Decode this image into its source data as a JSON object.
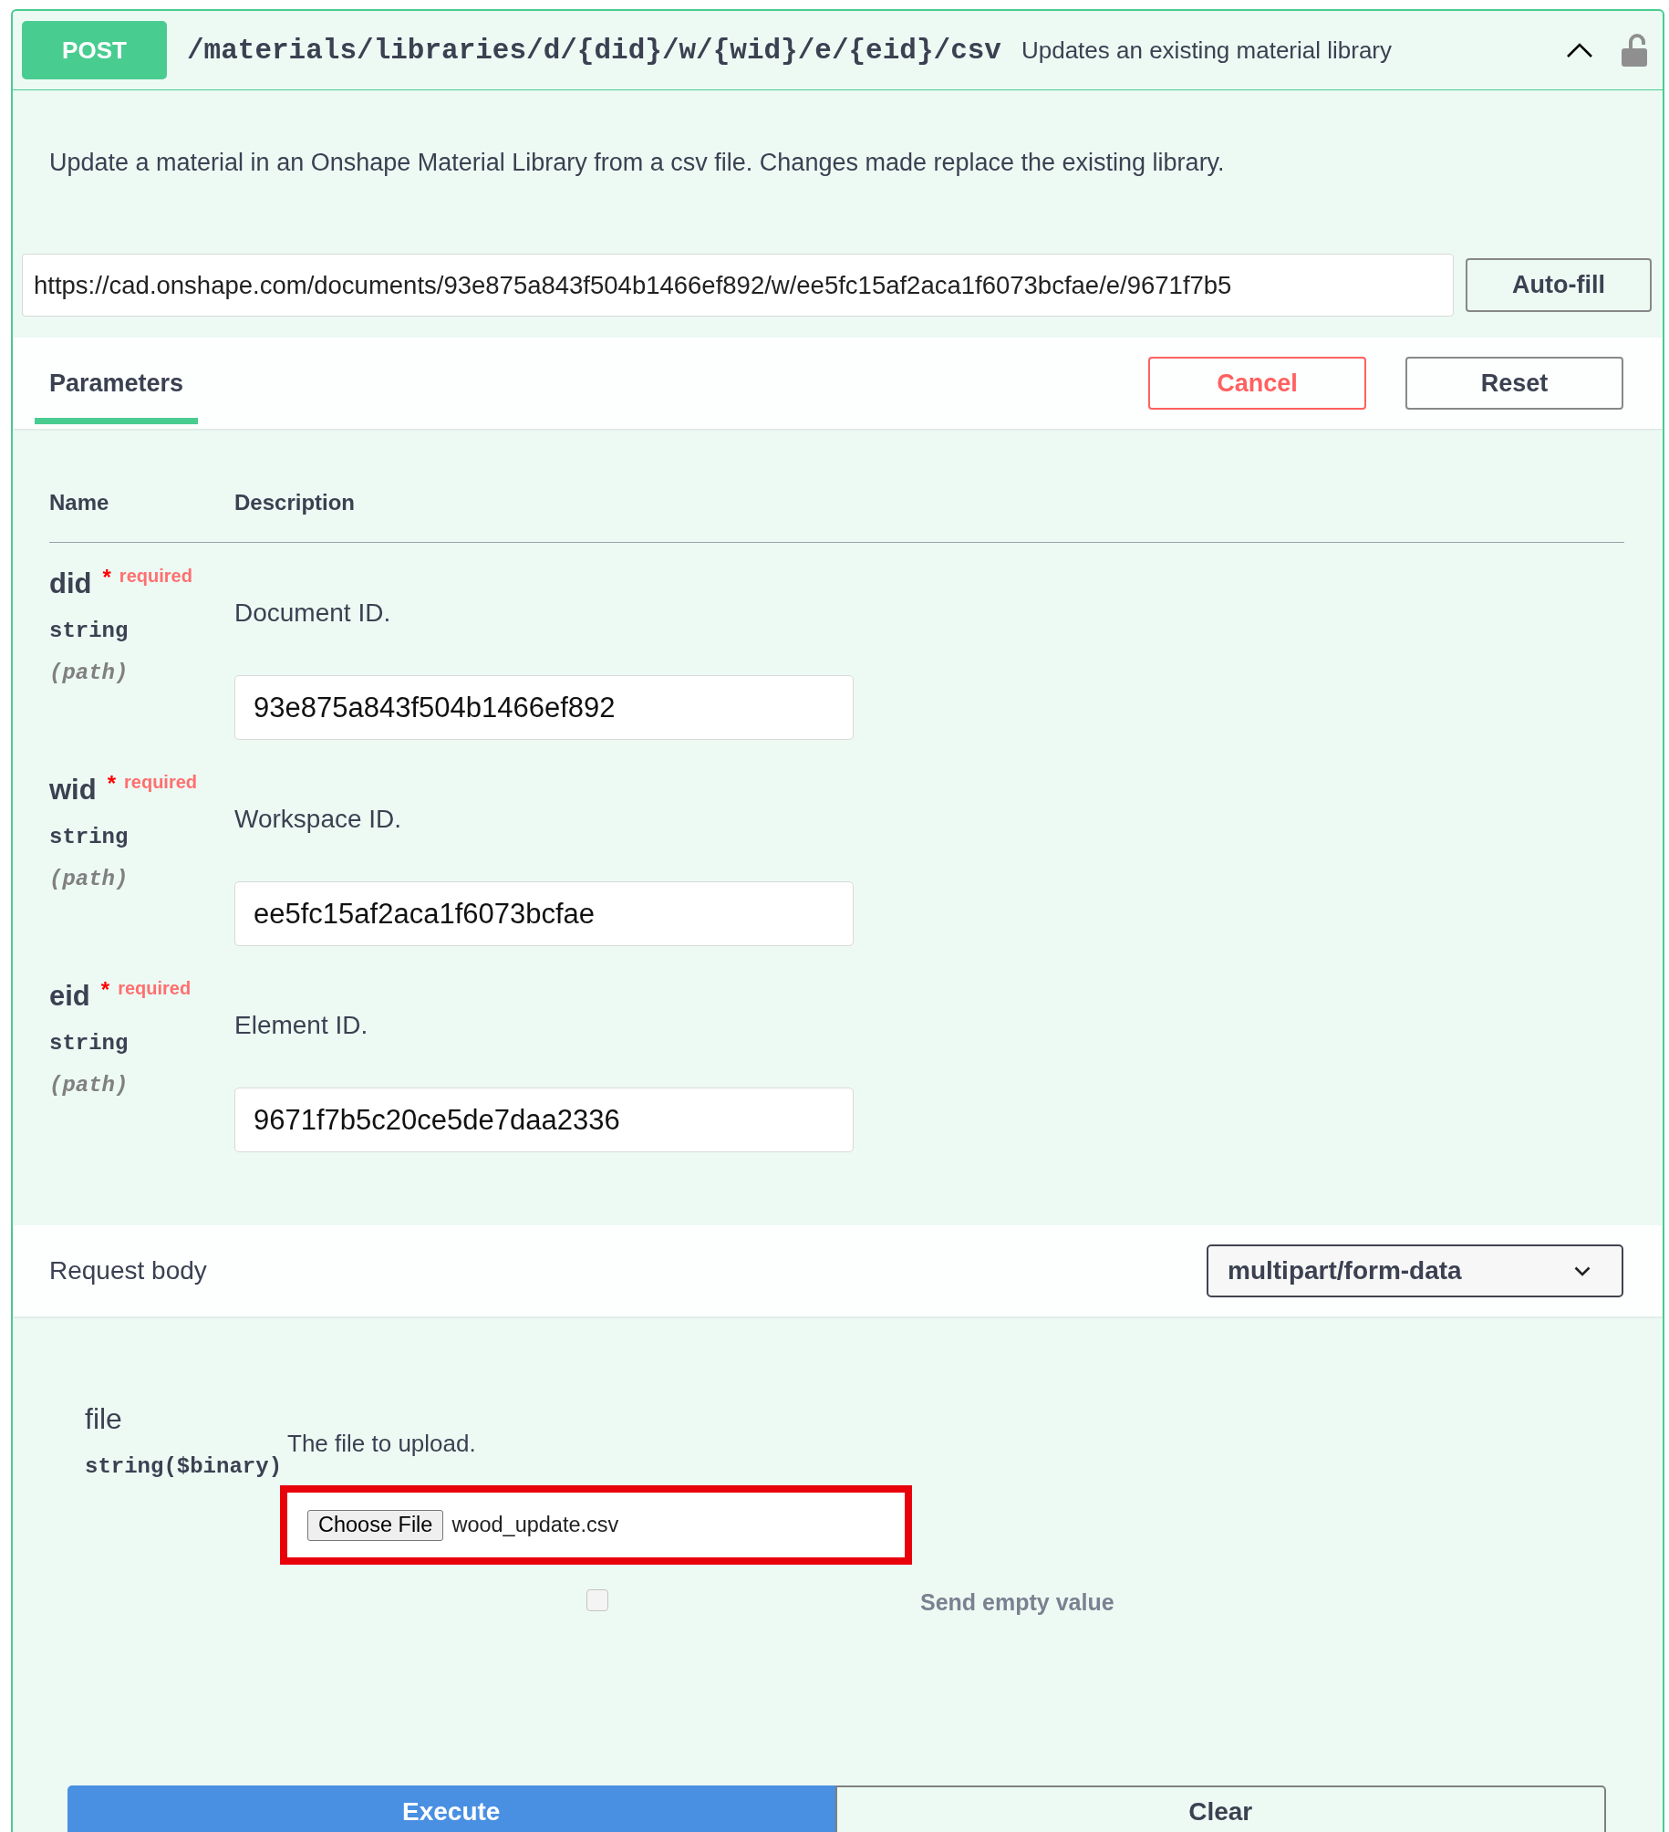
{
  "operation": {
    "method": "POST",
    "path": "/materials/libraries/d/{did}/w/{wid}/e/{eid}/csv",
    "summary": "Updates an existing material library",
    "expanded": true
  },
  "description": "Update a material in an Onshape Material Library from a csv file. Changes made replace the existing library.",
  "url_field": {
    "value": "https://cad.onshape.com/documents/93e875a843f504b1466ef892/w/ee5fc15af2aca1f6073bcfae/e/9671f7b5",
    "button": "Auto-fill"
  },
  "tabs": [
    {
      "label": "Parameters",
      "selected": true
    }
  ],
  "tab_buttons": [
    {
      "label": "Cancel",
      "kind": "cancel"
    },
    {
      "label": "Reset",
      "kind": "reset"
    }
  ],
  "parameters": {
    "columns": [
      "Name",
      "Description"
    ],
    "rows": [
      {
        "name": "did",
        "required_mark": "*",
        "required_label": "required",
        "type": "string",
        "location": "(path)",
        "description": "Document ID.",
        "value": "93e875a843f504b1466ef892"
      },
      {
        "name": "wid",
        "required_mark": "*",
        "required_label": "required",
        "type": "string",
        "location": "(path)",
        "description": "Workspace ID.",
        "value": "ee5fc15af2aca1f6073bcfae"
      },
      {
        "name": "eid",
        "required_mark": "*",
        "required_label": "required",
        "type": "string",
        "location": "(path)",
        "description": "Element ID.",
        "value": "9671f7b5c20ce5de7daa2336"
      }
    ]
  },
  "request_body": {
    "label": "Request body",
    "content_type": "multipart/form-data",
    "fields": [
      {
        "name": "file",
        "type": "string($binary)",
        "description": "The file to upload.",
        "choose_button": "Choose File",
        "file_name": "wood_update.csv",
        "highlighted": true,
        "send_empty": {
          "label": "Send empty value",
          "checked": false
        }
      }
    ]
  },
  "actions": [
    {
      "label": "Execute",
      "kind": "execute"
    },
    {
      "label": "Clear",
      "kind": "clear"
    }
  ]
}
